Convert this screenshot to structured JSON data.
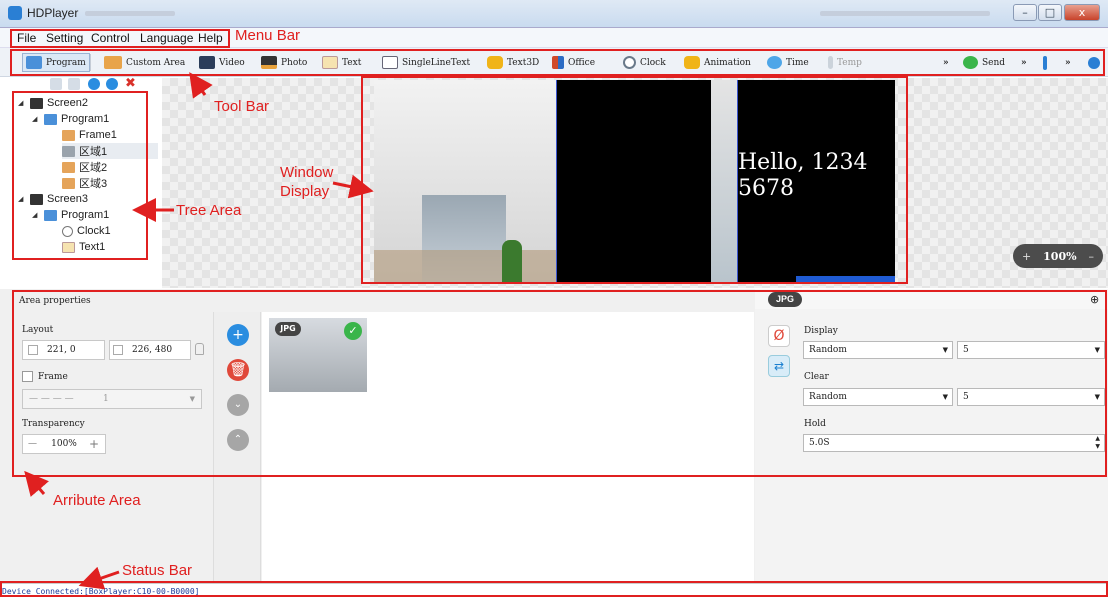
{
  "app": {
    "title": "HDPlayer"
  },
  "window_controls": {
    "minimize": "–",
    "maximize": "□",
    "close": "x"
  },
  "menu": {
    "items": [
      "File",
      "Setting",
      "Control",
      "Language",
      "Help"
    ]
  },
  "toolbar": {
    "items": [
      "Program",
      "Custom Area",
      "Video",
      "Photo",
      "Text",
      "SingleLineText",
      "Text3D",
      "Office",
      "Clock",
      "Animation",
      "Time",
      "Temp"
    ],
    "more1": "»",
    "send": "Send",
    "more2": "»",
    "more3": "»"
  },
  "tree": {
    "screen2": "Screen2",
    "program1_a": "Program1",
    "frame1": "Frame1",
    "area1": "区域1",
    "area2": "区域2",
    "area3": "区域3",
    "screen3": "Screen3",
    "program1_b": "Program1",
    "clock1": "Clock1",
    "text1": "Text1"
  },
  "display": {
    "text": "Hello, 1234 5678",
    "zoom": "100%",
    "zoom_plus": "+",
    "zoom_minus": "–"
  },
  "area_properties": {
    "header": "Area properties",
    "layout_label": "Layout",
    "position": "221, 0",
    "size": "226, 480",
    "frame_label": "Frame",
    "frame_value": "1",
    "transparency_label": "Transparency",
    "transparency_value": "100%",
    "minus": "—",
    "plus": "+"
  },
  "media": {
    "badge": "JPG",
    "header_badge": "JPG"
  },
  "effects": {
    "display_label": "Display",
    "display_mode": "Random",
    "display_speed": "5",
    "clear_label": "Clear",
    "clear_mode": "Random",
    "clear_speed": "5",
    "hold_label": "Hold",
    "hold_value": "5.0S"
  },
  "status": {
    "text": "Device Connected:[BoxPlayer:C10-00-B0000]"
  },
  "annotations": {
    "menu_bar": "Menu Bar",
    "tool_bar": "Tool Bar",
    "window_display": "Window Display",
    "tree_area": "Tree Area",
    "attribute_area": "Arribute Area",
    "status_bar": "Status Bar"
  },
  "colors": {
    "annotation": "#e02020",
    "accent_blue": "#2a7fd4",
    "delete_red": "#e0483a",
    "selected_green": "#3ab54a"
  }
}
